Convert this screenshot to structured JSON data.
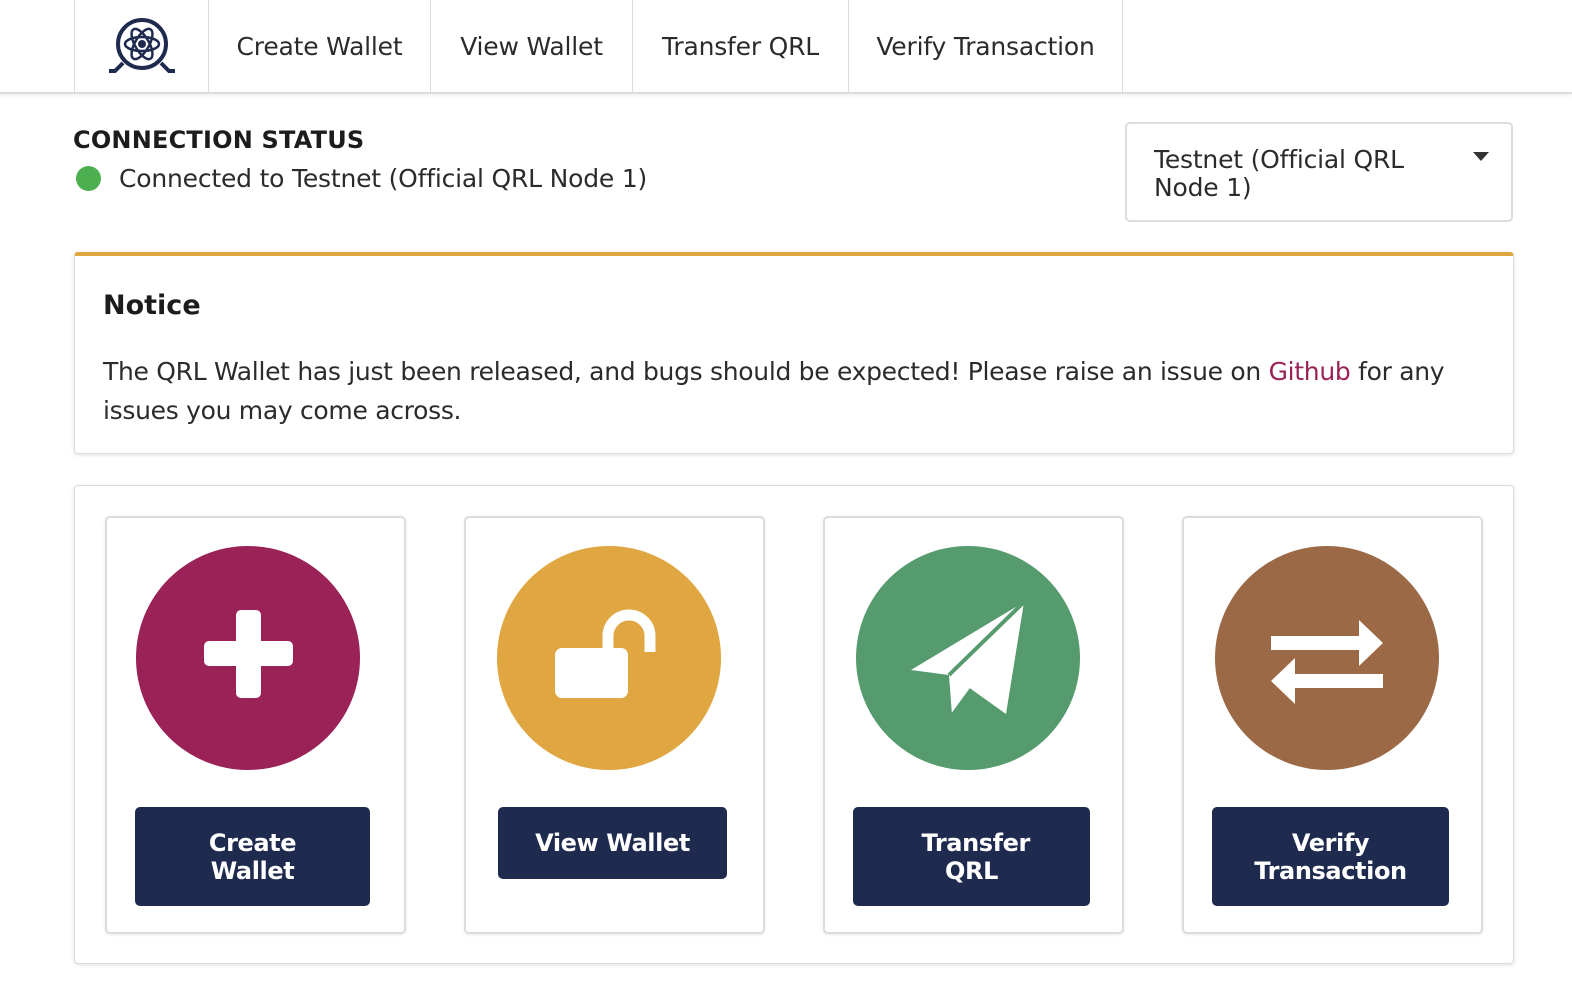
{
  "nav": {
    "logo_icon": "qrl-atom-logo-icon",
    "items": [
      {
        "label": "Create Wallet"
      },
      {
        "label": "View Wallet"
      },
      {
        "label": "Transfer QRL"
      },
      {
        "label": "Verify Transaction"
      }
    ]
  },
  "connection": {
    "title": "CONNECTION STATUS",
    "status_text": "Connected to Testnet (Official QRL Node 1)",
    "status_color": "#4caf50",
    "network_selected": "Testnet (Official QRL Node 1)"
  },
  "notice": {
    "title": "Notice",
    "body_before": "The QRL Wallet has just been released, and bugs should be expected! Please raise an issue on ",
    "link_text": "Github",
    "body_after": " for any issues you may come across.",
    "accent_color": "#e0a642"
  },
  "actions": [
    {
      "label": "Create Wallet",
      "icon": "plus-icon",
      "color": "#9a2257"
    },
    {
      "label": "View Wallet",
      "icon": "unlock-icon",
      "color": "#e0a642"
    },
    {
      "label": "Transfer QRL",
      "icon": "paper-plane-icon",
      "color": "#569b6e"
    },
    {
      "label": "Verify Transaction",
      "icon": "exchange-arrows-icon",
      "color": "#9c6946"
    }
  ],
  "colors": {
    "button_bg": "#1f2a4f",
    "link": "#9a2257"
  }
}
